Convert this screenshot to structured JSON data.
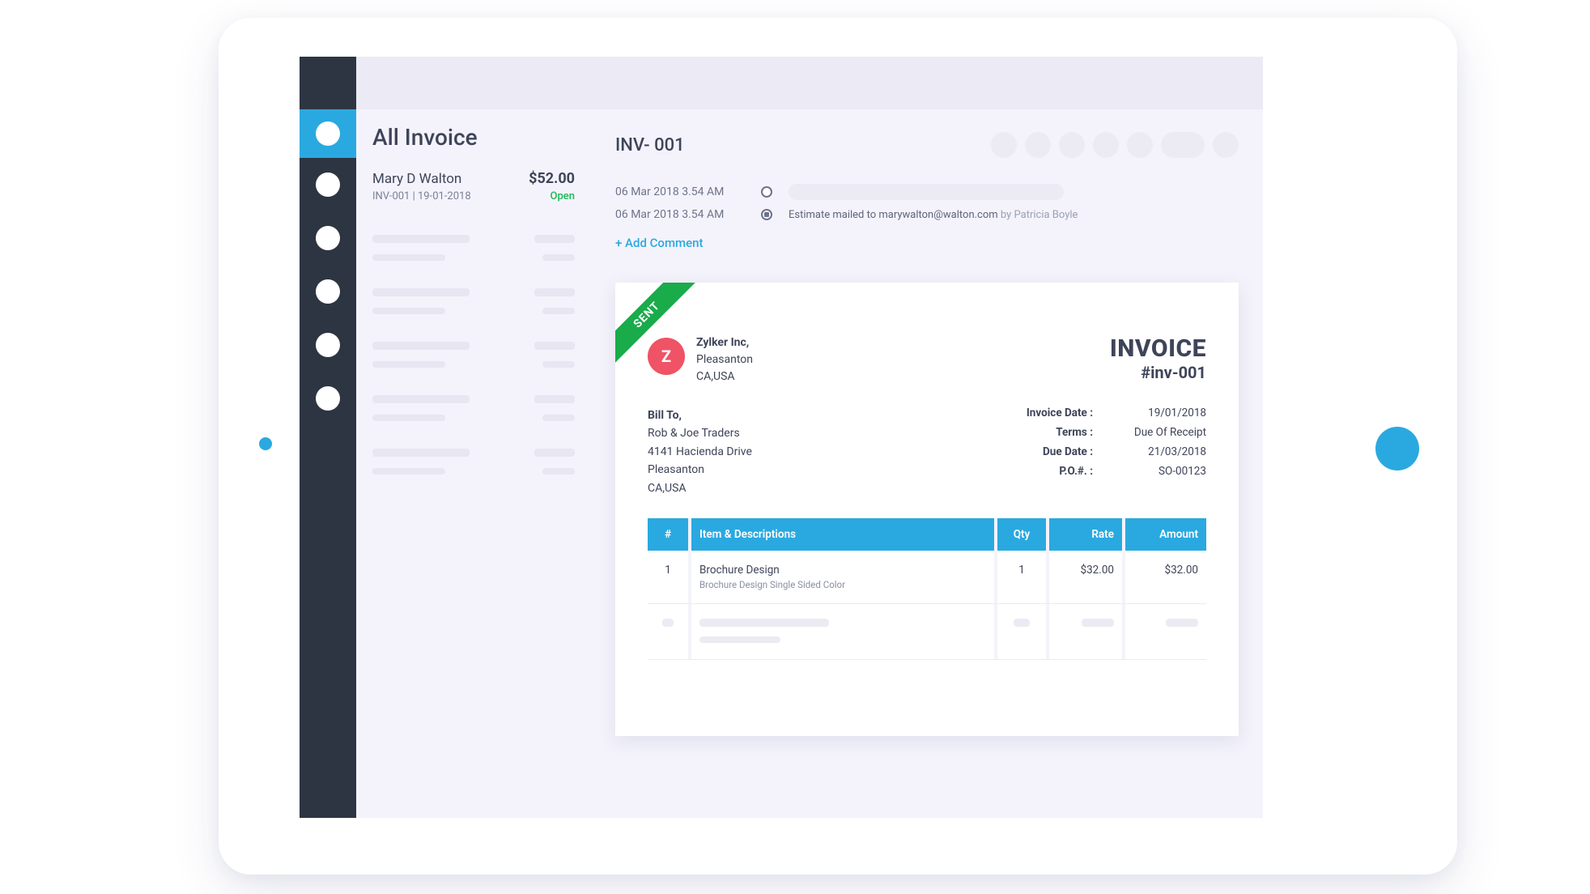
{
  "list": {
    "title": "All Invoice",
    "item": {
      "customer": "Mary D Walton",
      "amount": "$52.00",
      "ref": "INV-001 | 19-01-2018",
      "status": "Open"
    }
  },
  "detail": {
    "title": "INV- 001",
    "timeline": [
      {
        "time": "06 Mar 2018 3.54 AM",
        "text": "",
        "placeholder": true
      },
      {
        "time": "06 Mar 2018 3.54 AM",
        "text": "Estimate mailed to marywalton@walton.com",
        "by": "by Patricia Boyle",
        "placeholder": false
      }
    ],
    "addComment": "+ Add Comment"
  },
  "doc": {
    "ribbon": "SENT",
    "vendorInitial": "Z",
    "vendor": {
      "name": "Zylker Inc,",
      "city": "Pleasanton",
      "region": "CA,USA"
    },
    "invoiceTitle": "INVOICE",
    "invoiceNumber": "#inv-001",
    "billToLabel": "Bill To,",
    "billTo": {
      "name": "Rob & Joe Traders",
      "street": "4141 Hacienda Drive",
      "city": "Pleasanton",
      "region": "CA,USA"
    },
    "meta": {
      "invoiceDateLabel": "Invoice Date :",
      "invoiceDate": "19/01/2018",
      "termsLabel": "Terms :",
      "terms": "Due Of Receipt",
      "dueDateLabel": "Due Date :",
      "dueDate": "21/03/2018",
      "poLabel": "P.O.#. :",
      "po": "SO-00123"
    },
    "columns": {
      "num": "#",
      "item": "Item & Descriptions",
      "qty": "Qty",
      "rate": "Rate",
      "amount": "Amount"
    },
    "rows": [
      {
        "num": "1",
        "item": "Brochure Design",
        "desc": "Brochure Design Single Sided Color",
        "qty": "1",
        "rate": "$32.00",
        "amount": "$32.00"
      }
    ]
  }
}
